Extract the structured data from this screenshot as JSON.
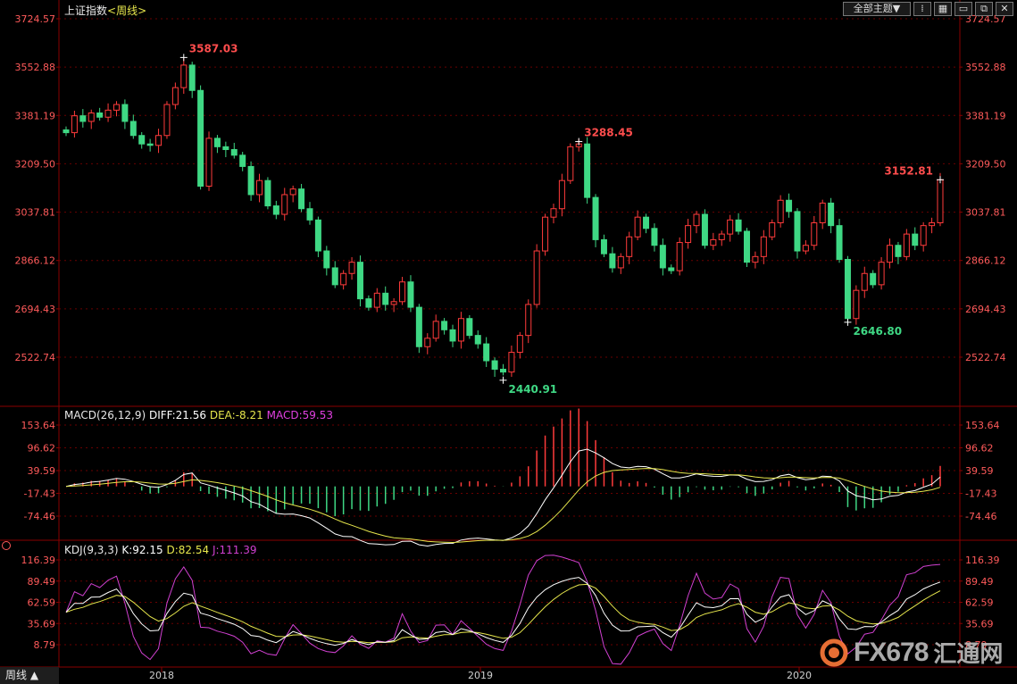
{
  "header": {
    "index_name": "上证指数",
    "period": "<周线>",
    "theme_button": "全部主题▼",
    "toolbar_icons": [
      "tile-icon",
      "grid-icon",
      "window-icon",
      "window-restore-icon",
      "close-icon"
    ]
  },
  "macd_header": {
    "name": "MACD(26,12,9)",
    "diff_text": "DIFF:21.56",
    "dea_text": "DEA:-8.21",
    "macd_text": "MACD:59.53"
  },
  "kdj_header": {
    "name": "KDJ(9,3,3)",
    "k_text": "K:92.15",
    "d_text": "D:82.54",
    "j_text": "J:111.39"
  },
  "bottom_tab": "周线 ▲",
  "watermark": {
    "brand": "FX678",
    "cn": "汇通网"
  },
  "colors": {
    "up": "#ff3b3b",
    "down": "#3fd884",
    "label_red": "#ff4d4d",
    "label_green": "#3fd884",
    "grid": "#6a0000",
    "diff": "#ffffff",
    "dea": "#e6e64c",
    "macd_text": "#e040e0",
    "k": "#ffffff",
    "d": "#e6e64c",
    "j": "#d040d0"
  },
  "chart_data": [
    {
      "type": "candlestick",
      "title": "上证指数 <周线>",
      "y_ticks": [
        3724.57,
        3552.88,
        3381.19,
        3209.5,
        3037.81,
        2866.12,
        2694.43,
        2522.74
      ],
      "x_labels": [
        "2018",
        "2019",
        "2020"
      ],
      "annotations": [
        {
          "label": "3587.03",
          "value": 3587.03
        },
        {
          "label": "2440.91",
          "value": 2440.91
        },
        {
          "label": "3288.45",
          "value": 3288.45
        },
        {
          "label": "2646.80",
          "value": 2646.8
        },
        {
          "label": "3152.81",
          "value": 3152.81
        }
      ],
      "weekly_close": [
        3320,
        3380,
        3360,
        3390,
        3375,
        3400,
        3420,
        3360,
        3310,
        3280,
        3275,
        3310,
        3420,
        3480,
        3560,
        3470,
        3130,
        3300,
        3270,
        3260,
        3240,
        3200,
        3100,
        3150,
        3060,
        3030,
        3100,
        3120,
        3050,
        3010,
        2900,
        2840,
        2780,
        2820,
        2860,
        2730,
        2700,
        2750,
        2710,
        2720,
        2790,
        2700,
        2560,
        2590,
        2650,
        2620,
        2580,
        2660,
        2600,
        2570,
        2510,
        2480,
        2470,
        2540,
        2600,
        2710,
        2900,
        3020,
        3050,
        3150,
        3270,
        3280,
        3090,
        2940,
        2890,
        2840,
        2880,
        2950,
        3020,
        2980,
        2920,
        2840,
        2830,
        2930,
        2990,
        3030,
        2920,
        2940,
        2960,
        3010,
        2970,
        2860,
        2880,
        2950,
        3000,
        3080,
        3040,
        2900,
        2920,
        3000,
        3070,
        2990,
        2870,
        2660,
        2760,
        2820,
        2780,
        2860,
        2920,
        2880,
        2960,
        2920,
        2990,
        3000,
        3152.81
      ]
    },
    {
      "type": "bar+line",
      "title": "MACD(26,12,9)",
      "y_ticks": [
        153.64,
        96.62,
        39.59,
        -17.43,
        -74.46
      ],
      "series": [
        {
          "name": "DIFF",
          "last": 21.56
        },
        {
          "name": "DEA",
          "last": -8.21
        },
        {
          "name": "MACD",
          "last": 59.53
        }
      ]
    },
    {
      "type": "line",
      "title": "KDJ(9,3,3)",
      "y_ticks": [
        116.39,
        89.49,
        62.59,
        35.69,
        8.79
      ],
      "series": [
        {
          "name": "K",
          "last": 92.15
        },
        {
          "name": "D",
          "last": 82.54
        },
        {
          "name": "J",
          "last": 111.39
        }
      ]
    }
  ]
}
